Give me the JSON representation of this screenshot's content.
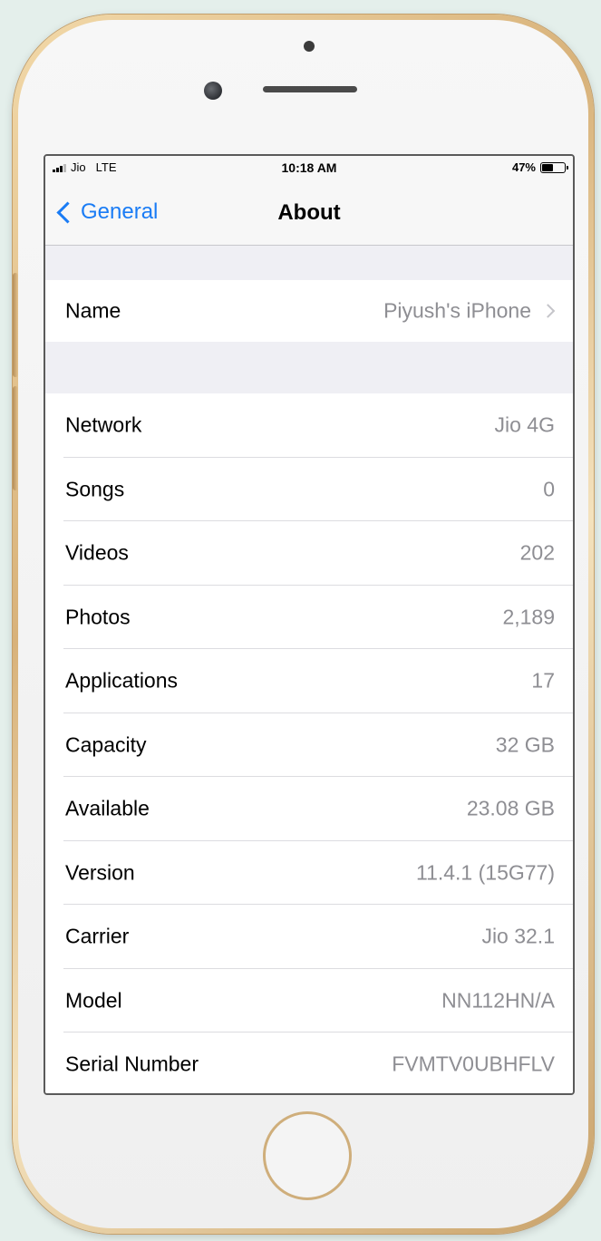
{
  "status_bar": {
    "carrier": "Jio",
    "network_type": "LTE",
    "time": "10:18 AM",
    "battery_percent": "47%",
    "battery_level": 0.47
  },
  "nav": {
    "back_label": "General",
    "title": "About"
  },
  "name_row": {
    "label": "Name",
    "value": "Piyush's iPhone"
  },
  "info_rows": [
    {
      "label": "Network",
      "value": "Jio 4G"
    },
    {
      "label": "Songs",
      "value": "0"
    },
    {
      "label": "Videos",
      "value": "202"
    },
    {
      "label": "Photos",
      "value": "2,189"
    },
    {
      "label": "Applications",
      "value": "17"
    },
    {
      "label": "Capacity",
      "value": "32 GB"
    },
    {
      "label": "Available",
      "value": "23.08 GB"
    },
    {
      "label": "Version",
      "value": "11.4.1 (15G77)"
    },
    {
      "label": "Carrier",
      "value": "Jio 32.1"
    },
    {
      "label": "Model",
      "value": "NN112HN/A"
    },
    {
      "label": "Serial Number",
      "value": "FVMTV0UBHFLV"
    }
  ],
  "colors": {
    "accent": "#1a7cf5",
    "secondary_text": "#8e8e93",
    "grouped_background": "#efeff4",
    "phone_frame": "#d8b27a"
  }
}
